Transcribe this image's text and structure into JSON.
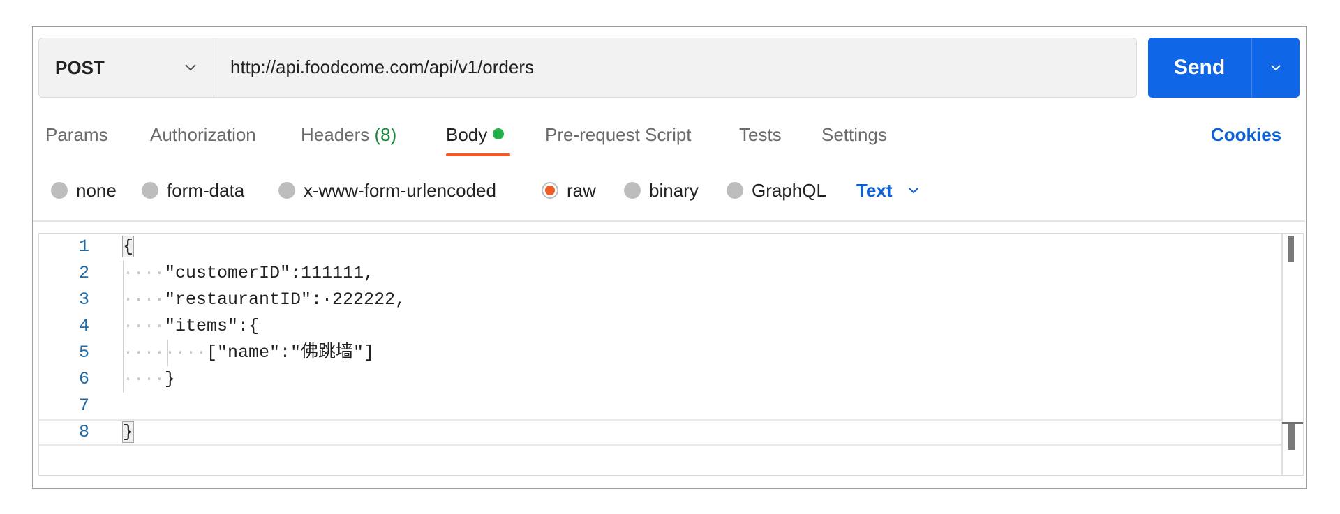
{
  "request": {
    "method": "POST",
    "url": "http://api.foodcome.com/api/v1/orders"
  },
  "send": {
    "label": "Send"
  },
  "tabs": [
    {
      "label": "Params"
    },
    {
      "label": "Authorization"
    },
    {
      "label": "Headers",
      "count": "(8)"
    },
    {
      "label": "Body",
      "active": true
    },
    {
      "label": "Pre-request Script"
    },
    {
      "label": "Tests"
    },
    {
      "label": "Settings"
    }
  ],
  "cookies_label": "Cookies",
  "body_modes": [
    {
      "label": "none"
    },
    {
      "label": "form-data"
    },
    {
      "label": "x-www-form-urlencoded"
    },
    {
      "label": "raw",
      "checked": true
    },
    {
      "label": "binary"
    },
    {
      "label": "GraphQL"
    }
  ],
  "raw_format": {
    "selected": "Text"
  },
  "editor": {
    "line_numbers": [
      "1",
      "2",
      "3",
      "4",
      "5",
      "6",
      "7",
      "8"
    ],
    "lines": [
      {
        "ws": "",
        "text": "{"
      },
      {
        "ws": "····",
        "text": "\"customerID\":111111,"
      },
      {
        "ws": "····",
        "text": "\"restaurantID\":·222222,"
      },
      {
        "ws": "····",
        "text": "\"items\":{"
      },
      {
        "ws": "········",
        "text": "[\"name\":\"佛跳墙\"]"
      },
      {
        "ws": "····",
        "text": "}"
      },
      {
        "ws": "",
        "text": ""
      },
      {
        "ws": "",
        "text": "}"
      }
    ]
  },
  "colors": {
    "accent_blue": "#0f66e6",
    "link_blue": "#0c61d9",
    "tab_active_underline": "#ef5b25",
    "body_dot_green": "#23b04b",
    "headers_count_green": "#1d8a3b",
    "line_number_blue": "#1f6aa5"
  },
  "icons": {
    "method_dropdown": "chevron-down-icon",
    "send_dropdown": "chevron-down-icon",
    "format_dropdown": "chevron-down-icon"
  }
}
